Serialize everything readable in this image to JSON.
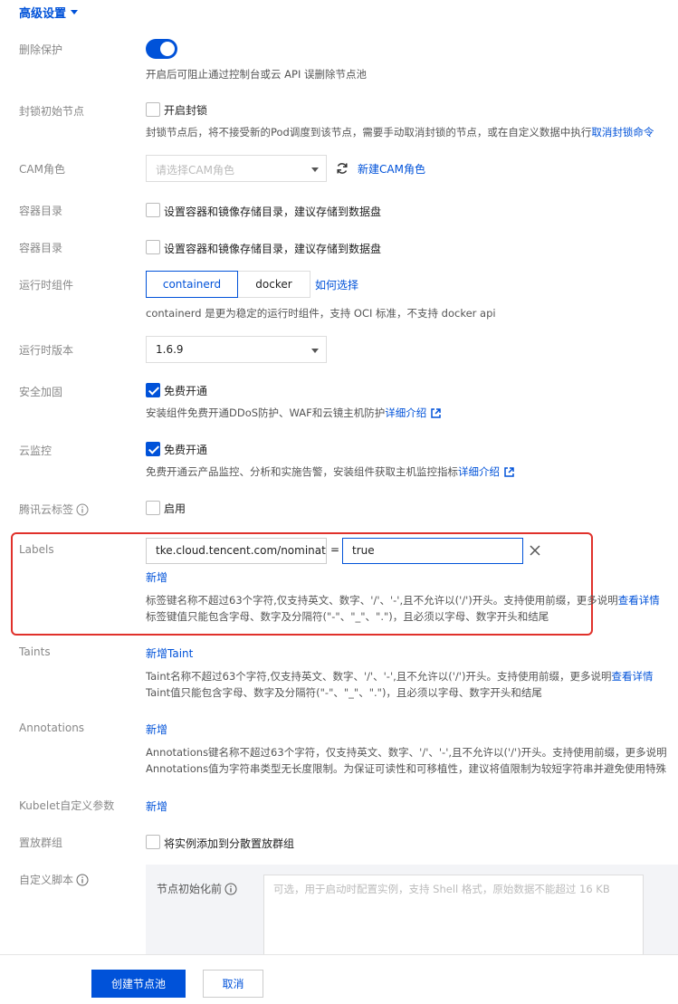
{
  "section_title": "高级设置",
  "delete_protection": {
    "label": "删除保护",
    "hint": "开启后可阻止通过控制台或云 API 误删除节点池"
  },
  "lock_init": {
    "label": "封锁初始节点",
    "checkbox_label": "开启封锁",
    "hint": "封锁节点后，将不接受新的Pod调度到该节点，需要手动取消封锁的节点，或在自定义数据中执行",
    "hint_link": "取消封锁命令"
  },
  "cam_role": {
    "label": "CAM角色",
    "placeholder": "请选择CAM角色",
    "new_link": "新建CAM角色"
  },
  "container_dir_1": {
    "label": "容器目录",
    "checkbox_label": "设置容器和镜像存储目录，建议存储到数据盘"
  },
  "container_dir_2": {
    "label": "容器目录",
    "checkbox_label": "设置容器和镜像存储目录，建议存储到数据盘"
  },
  "runtime": {
    "label": "运行时组件",
    "options": [
      "containerd",
      "docker"
    ],
    "selected": "containerd",
    "how_link": "如何选择",
    "hint": "containerd 是更为稳定的运行时组件，支持 OCI 标准，不支持 docker api"
  },
  "runtime_version": {
    "label": "运行时版本",
    "value": "1.6.9"
  },
  "security": {
    "label": "安全加固",
    "checkbox_label": "免费开通",
    "hint": "安装组件免费开通DDoS防护、WAF和云镜主机防护",
    "link": "详细介绍"
  },
  "monitor": {
    "label": "云监控",
    "checkbox_label": "免费开通",
    "hint": "免费开通云产品监控、分析和实施告警，安装组件获取主机监控指标",
    "link": "详细介绍"
  },
  "tencent_tag": {
    "label": "腾讯云标签",
    "checkbox_label": "启用"
  },
  "labels": {
    "label": "Labels",
    "key": "tke.cloud.tencent.com/nominated",
    "equals": "=",
    "value": "true",
    "add": "新增",
    "hint1": "标签键名称不超过63个字符,仅支持英文、数字、'/'、'-',且不允许以('/')开头。支持使用前缀，更多说明",
    "hint1_link": "查看详情",
    "hint2": "标签键值只能包含字母、数字及分隔符(\"-\"、\"_\"、\".\")，且必须以字母、数字开头和结尾"
  },
  "taints": {
    "label": "Taints",
    "add": "新增Taint",
    "hint1": "Taint名称不超过63个字符,仅支持英文、数字、'/'、'-',且不允许以('/')开头。支持使用前缀，更多说明",
    "hint1_link": "查看详情",
    "hint2": "Taint值只能包含字母、数字及分隔符(\"-\"、\"_\"、\".\")，且必须以字母、数字开头和结尾"
  },
  "annotations": {
    "label": "Annotations",
    "add": "新增",
    "hint1": "Annotations键名称不超过63个字符，仅支持英文、数字、'/'、'-',且不允许以('/')开头。支持使用前缀，更多说明",
    "hint2": "Annotations值为字符串类型无长度限制。为保证可读性和可移植性，建议将值限制为较短字符串并避免使用特殊"
  },
  "kubelet": {
    "label": "Kubelet自定义参数",
    "add": "新增"
  },
  "placement": {
    "label": "置放群组",
    "checkbox_label": "将实例添加到分散置放群组"
  },
  "custom_script": {
    "label": "自定义脚本",
    "pre_init_label": "节点初始化前",
    "placeholder": "可选，用于启动时配置实例，支持 Shell 格式，原始数据不能超过 16 KB"
  },
  "footer": {
    "create": "创建节点池",
    "cancel": "取消"
  },
  "colors": {
    "accent": "#0052d9",
    "highlight_border": "#e0312b"
  }
}
